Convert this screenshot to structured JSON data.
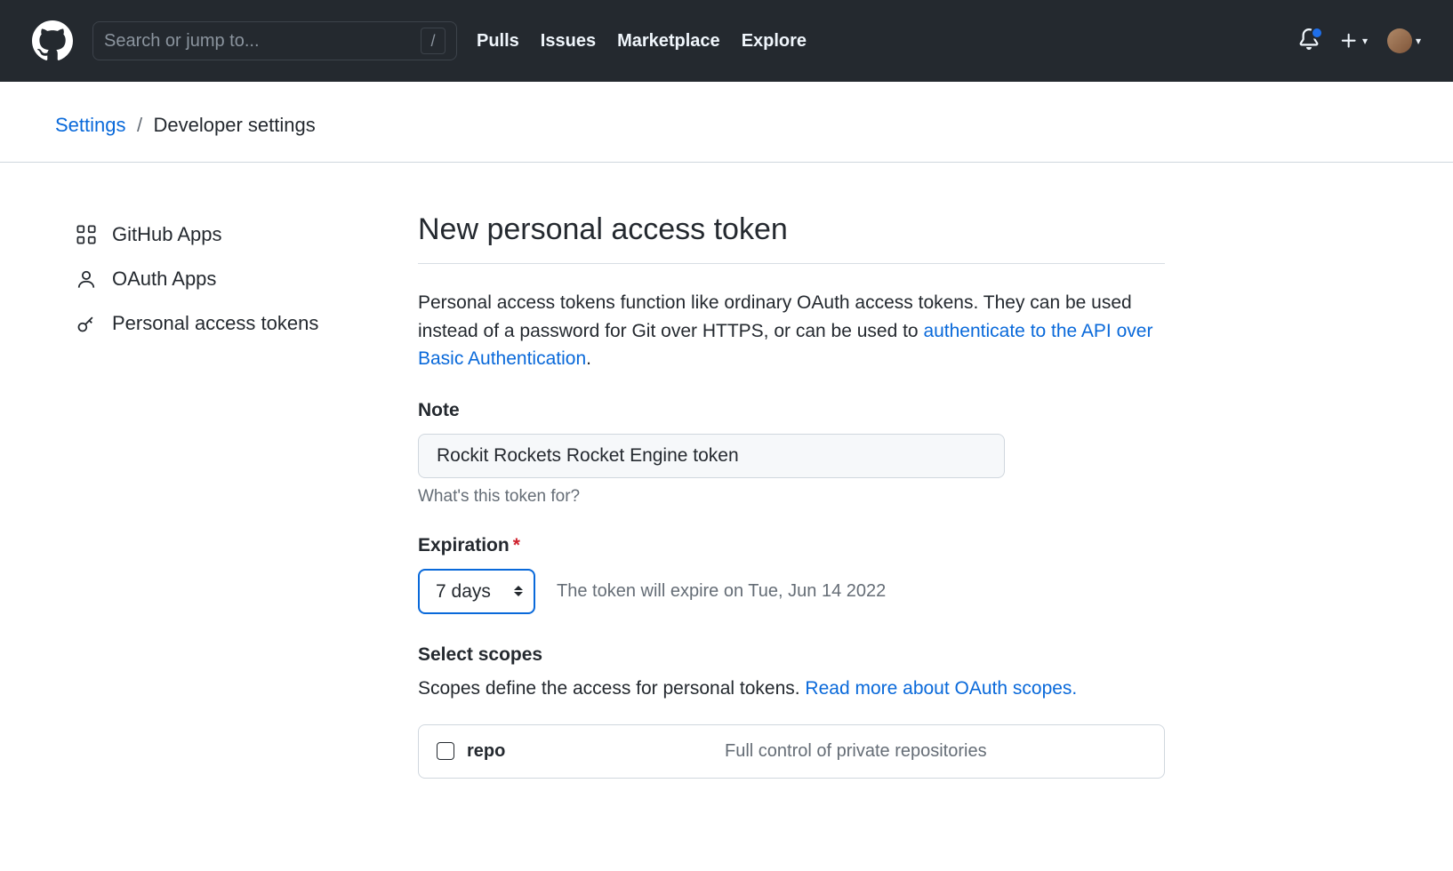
{
  "header": {
    "search_placeholder": "Search or jump to...",
    "slash_key": "/",
    "nav": [
      "Pulls",
      "Issues",
      "Marketplace",
      "Explore"
    ]
  },
  "breadcrumb": {
    "root": "Settings",
    "sep": "/",
    "current": "Developer settings"
  },
  "sidebar": {
    "items": [
      {
        "label": "GitHub Apps"
      },
      {
        "label": "OAuth Apps"
      },
      {
        "label": "Personal access tokens"
      }
    ]
  },
  "main": {
    "title": "New personal access token",
    "description_start": "Personal access tokens function like ordinary OAuth access tokens. They can be used instead of a password for Git over HTTPS, or can be used to ",
    "description_link": "authenticate to the API over Basic Authentication",
    "description_end": ".",
    "note_label": "Note",
    "note_value": "Rockit Rockets Rocket Engine token",
    "note_helper": "What's this token for?",
    "expiration_label": "Expiration",
    "expiration_value": "7 days",
    "expiration_note": "The token will expire on Tue, Jun 14 2022",
    "scopes_label": "Select scopes",
    "scopes_desc_start": "Scopes define the access for personal tokens. ",
    "scopes_desc_link": "Read more about OAuth scopes.",
    "scope_repo_name": "repo",
    "scope_repo_desc": "Full control of private repositories"
  }
}
